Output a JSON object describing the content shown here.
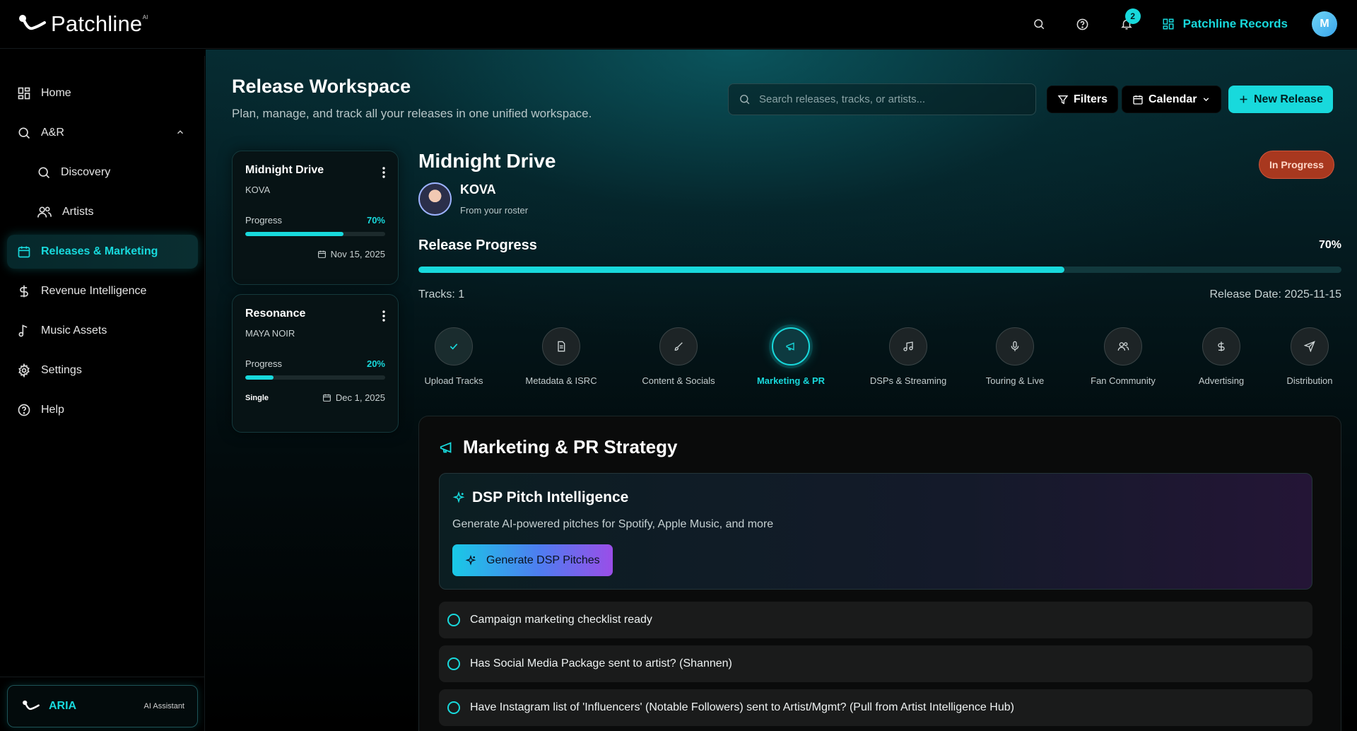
{
  "brand": {
    "name": "Patchline",
    "ai_mark": "AI"
  },
  "topbar": {
    "notification_count": "2",
    "org_name": "Patchline Records",
    "avatar_initial": "M"
  },
  "sidebar": {
    "items": [
      {
        "label": "Home",
        "icon": "grid-icon"
      },
      {
        "label": "A&R",
        "icon": "search-icon"
      },
      {
        "label": "Discovery",
        "icon": "search-icon"
      },
      {
        "label": "Artists",
        "icon": "users-icon"
      },
      {
        "label": "Releases & Marketing",
        "icon": "calendar-icon"
      },
      {
        "label": "Revenue Intelligence",
        "icon": "dollar-icon"
      },
      {
        "label": "Music Assets",
        "icon": "music-note-icon"
      },
      {
        "label": "Settings",
        "icon": "gear-icon"
      },
      {
        "label": "Help",
        "icon": "help-icon"
      }
    ],
    "assistant": {
      "name": "ARIA",
      "subtitle": "AI Assistant"
    }
  },
  "header": {
    "title": "Release Workspace",
    "subtitle": "Plan, manage, and track all your releases in one unified workspace.",
    "search_placeholder": "Search releases, tracks, or artists...",
    "filters_label": "Filters",
    "calendar_label": "Calendar",
    "new_release_label": "New Release"
  },
  "releases": [
    {
      "title": "Midnight Drive",
      "artist": "KOVA",
      "progress_label": "Progress",
      "progress": "70%",
      "progress_value": 70,
      "type": "",
      "date": "Nov 15, 2025"
    },
    {
      "title": "Resonance",
      "artist": "MAYA NOIR",
      "progress_label": "Progress",
      "progress": "20%",
      "progress_value": 20,
      "type": "Single",
      "date": "Dec 1, 2025"
    }
  ],
  "detail": {
    "title": "Midnight Drive",
    "artist": "KOVA",
    "artist_sub": "From your roster",
    "status": "In Progress",
    "progress_label": "Release Progress",
    "progress": "70%",
    "progress_value": 70,
    "tracks": "Tracks: 1",
    "release_date": "Release Date: 2025-11-15",
    "steps": [
      {
        "label": "Upload Tracks",
        "icon": "check-icon",
        "state": "done"
      },
      {
        "label": "Metadata & ISRC",
        "icon": "document-icon",
        "state": "todo"
      },
      {
        "label": "Content & Socials",
        "icon": "brush-icon",
        "state": "todo"
      },
      {
        "label": "Marketing & PR",
        "icon": "megaphone-icon",
        "state": "active"
      },
      {
        "label": "DSPs & Streaming",
        "icon": "music-icon",
        "state": "todo"
      },
      {
        "label": "Touring & Live",
        "icon": "microphone-icon",
        "state": "todo"
      },
      {
        "label": "Fan Community",
        "icon": "users-icon",
        "state": "todo"
      },
      {
        "label": "Advertising",
        "icon": "dollar-icon",
        "state": "todo"
      },
      {
        "label": "Distribution",
        "icon": "send-icon",
        "state": "todo"
      }
    ]
  },
  "strategy": {
    "title": "Marketing & PR Strategy",
    "pitch": {
      "title": "DSP Pitch Intelligence",
      "subtitle": "Generate AI-powered pitches for Spotify, Apple Music, and more",
      "button": "Generate DSP Pitches"
    },
    "checklist": [
      "Campaign marketing checklist ready",
      "Has Social Media Package sent to artist? (Shannen)",
      "Have Instagram list of 'Influencers' (Notable Followers) sent to Artist/Mgmt? (Pull from Artist Intelligence Hub)"
    ]
  },
  "colors": {
    "accent": "#18d9dc",
    "status": "#a8381f",
    "background": "#000000"
  }
}
